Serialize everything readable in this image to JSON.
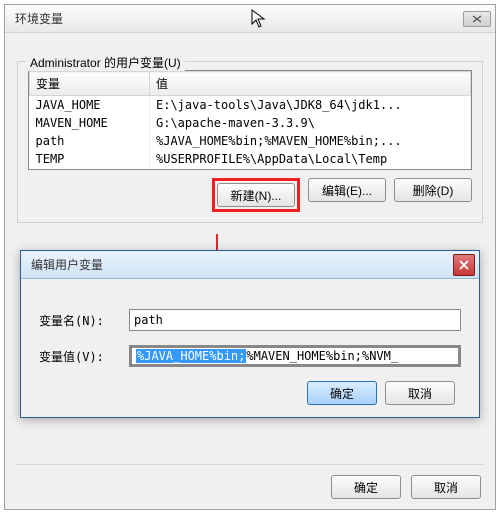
{
  "mainWindow": {
    "title": "环境变量",
    "group": {
      "title": "Administrator 的用户变量(U)",
      "columns": {
        "var": "变量",
        "val": "值"
      },
      "rows": [
        {
          "var": "JAVA_HOME",
          "val": "E:\\java-tools\\Java\\JDK8_64\\jdk1..."
        },
        {
          "var": "MAVEN_HOME",
          "val": "G:\\apache-maven-3.3.9\\"
        },
        {
          "var": "path",
          "val": "%JAVA_HOME%bin;%MAVEN_HOME%bin;..."
        },
        {
          "var": "TEMP",
          "val": "%USERPROFILE%\\AppData\\Local\\Temp"
        }
      ],
      "buttons": {
        "new": "新建(N)...",
        "edit": "编辑(E)...",
        "delete": "删除(D)"
      }
    },
    "bottomButtons": {
      "ok": "确定",
      "cancel": "取消"
    }
  },
  "editDialog": {
    "title": "编辑用户变量",
    "labels": {
      "name": "变量名(N):",
      "value": "变量值(V):"
    },
    "fields": {
      "name": "path",
      "valueSelected": "%JAVA_HOME%bin;",
      "valueRest": "%MAVEN_HOME%bin;%NVM_"
    },
    "buttons": {
      "ok": "确定",
      "cancel": "取消"
    }
  }
}
